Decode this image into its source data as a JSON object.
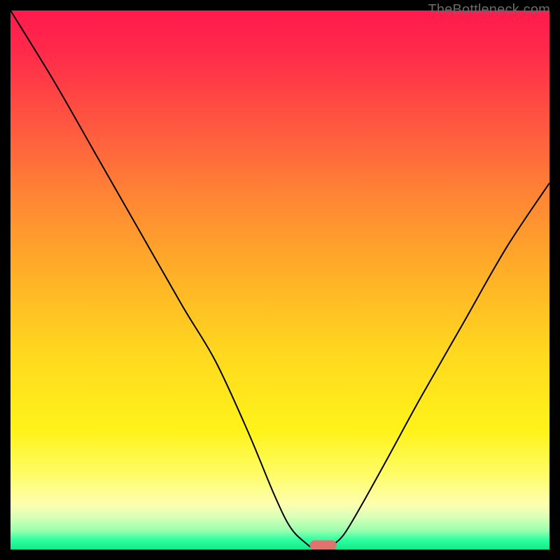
{
  "attribution": "TheBottleneck.com",
  "colors": {
    "line": "#000000",
    "marker_fill": "#e0736d",
    "marker_stroke": "#e0736d"
  },
  "chart_data": {
    "type": "line",
    "title": "",
    "xlabel": "",
    "ylabel": "",
    "xlim": [
      0,
      100
    ],
    "ylim": [
      0,
      100
    ],
    "series": [
      {
        "name": "bottleneck-curve",
        "x": [
          0,
          8,
          16,
          24,
          32,
          38,
          44,
          49,
          52,
          55,
          56.5,
          58,
          60,
          62,
          65,
          70,
          76,
          84,
          92,
          100
        ],
        "y": [
          100,
          87,
          73,
          59,
          45,
          35,
          22,
          10,
          4,
          1,
          0,
          0,
          1,
          3,
          8,
          17,
          28,
          42,
          56,
          68
        ]
      }
    ],
    "marker": {
      "name": "optimal-range",
      "x_start": 55.5,
      "x_end": 60.5,
      "y": 0.8,
      "thickness": 1.8
    }
  }
}
